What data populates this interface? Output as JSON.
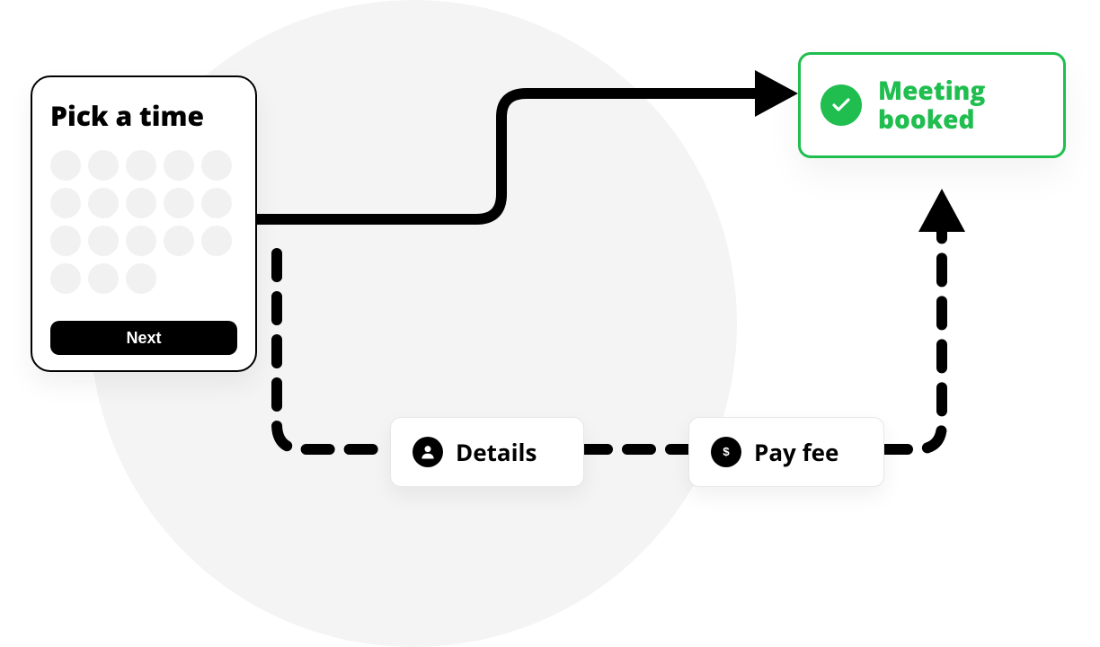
{
  "pick_card": {
    "title": "Pick a time",
    "next_label": "Next",
    "dot_rows": [
      5,
      5,
      5,
      3
    ]
  },
  "success": {
    "text": "Meeting booked",
    "color": "#1fbe4f"
  },
  "steps": {
    "details": {
      "label": "Details",
      "icon": "person-icon"
    },
    "payfee": {
      "label": "Pay fee",
      "icon": "dollar-icon"
    }
  },
  "flow": {
    "direct_path": "from: Pick a time → Meeting booked (solid arrow)",
    "optional_path": "from: Pick a time → Details → Pay fee → Meeting booked (dashed arrow)"
  }
}
